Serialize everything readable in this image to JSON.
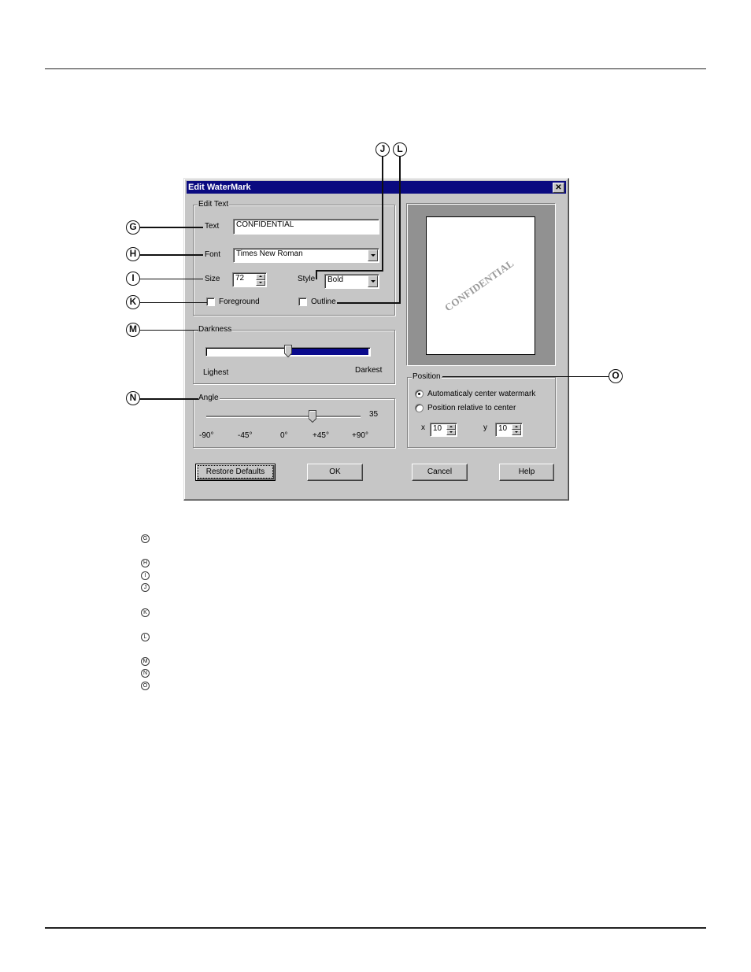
{
  "dialog": {
    "title": "Edit WaterMark",
    "close_icon": "close-icon",
    "edit_text_group": {
      "label": "Edit Text",
      "text_label": "Text",
      "text_value": "CONFIDENTIAL",
      "font_label": "Font",
      "font_value": "Times New Roman",
      "size_label": "Size",
      "size_value": "72",
      "style_label": "Style",
      "style_value": "Bold",
      "foreground_label": "Foreground",
      "foreground_checked": false,
      "outline_label": "Outline",
      "outline_checked": false
    },
    "darkness_group": {
      "label": "Darkness",
      "min_label": "Lighest",
      "max_label": "Darkest",
      "value_fraction": 0.5
    },
    "angle_group": {
      "label": "Angle",
      "value": "35",
      "ticks": [
        "-90°",
        "-45°",
        "0°",
        "+45°",
        "+90°"
      ]
    },
    "preview": {
      "watermark_text": "CONFIDENTIAL"
    },
    "position_group": {
      "label": "Position",
      "option_auto": "Automaticaly center watermark",
      "option_relative": "Position relative to center",
      "selected": "auto",
      "x_label": "x",
      "x_value": "10",
      "y_label": "y",
      "y_value": "10"
    },
    "buttons": {
      "restore_defaults": "Restore Defaults",
      "ok": "OK",
      "cancel": "Cancel",
      "help": "Help"
    }
  },
  "callouts": {
    "G": "G",
    "H": "H",
    "I": "I",
    "J": "J",
    "K": "K",
    "L": "L",
    "M": "M",
    "N": "N",
    "O": "O"
  },
  "legend": [
    "G",
    "H",
    "I",
    "J",
    "K",
    "L",
    "M",
    "N",
    "O"
  ]
}
